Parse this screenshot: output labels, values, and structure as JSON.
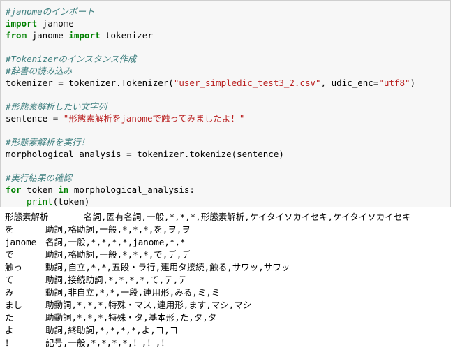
{
  "code_cell": {
    "c1": "#janomeのインポート",
    "l2_kw": "import",
    "l2_rest": " janome",
    "l3_kw1": "from",
    "l3_mid": " janome ",
    "l3_kw2": "import",
    "l3_rest": " tokenizer",
    "c2": "#Tokenizerのインスタンス作成",
    "c3": "#辞書の読み込み",
    "l6_a": "tokenizer ",
    "l6_op": "=",
    "l6_b": " tokenizer.Tokenizer(",
    "l6_s1": "\"user_simpledic_test3_2.csv\"",
    "l6_c": ", udic_enc",
    "l6_op2": "=",
    "l6_s2": "\"utf8\"",
    "l6_d": ")",
    "c4": "#形態素解析したい文字列",
    "l8_a": "sentence ",
    "l8_op": "=",
    "l8_s": " \"形態素解析をjanomeで触ってみましたよ！\"",
    "c5": "#形態素解析を実行！",
    "l10_a": "morphological_analysis ",
    "l10_op": "=",
    "l10_b": " tokenizer.tokenize(sentence)",
    "c6": "#実行結果の確認",
    "l12_kw1": "for",
    "l12_mid": " token ",
    "l12_kw2": "in",
    "l12_rest": " morphological_analysis:",
    "l13_fn": "print",
    "l13_rest": "(token)"
  },
  "output_rows": [
    {
      "surface": "形態素解析",
      "features": "名詞,固有名詞,一般,*,*,*,形態素解析,ケイタイソカイセキ,ケイタイソカイセキ"
    },
    {
      "surface": "を",
      "features": "助詞,格助詞,一般,*,*,*,を,ヲ,ヲ"
    },
    {
      "surface": "janome",
      "features": "名詞,一般,*,*,*,*,janome,*,*"
    },
    {
      "surface": "で",
      "features": "助詞,格助詞,一般,*,*,*,で,デ,デ"
    },
    {
      "surface": "触っ",
      "features": "動詞,自立,*,*,五段・ラ行,連用タ接続,触る,サワッ,サワッ"
    },
    {
      "surface": "て",
      "features": "助詞,接続助詞,*,*,*,*,て,テ,テ"
    },
    {
      "surface": "み",
      "features": "動詞,非自立,*,*,一段,連用形,みる,ミ,ミ"
    },
    {
      "surface": "まし",
      "features": "助動詞,*,*,*,特殊・マス,連用形,ます,マシ,マシ"
    },
    {
      "surface": "た",
      "features": "助動詞,*,*,*,特殊・タ,基本形,た,タ,タ"
    },
    {
      "surface": "よ",
      "features": "助詞,終助詞,*,*,*,*,よ,ヨ,ヨ"
    },
    {
      "surface": "！",
      "features": "記号,一般,*,*,*,*,！,！,！"
    }
  ]
}
